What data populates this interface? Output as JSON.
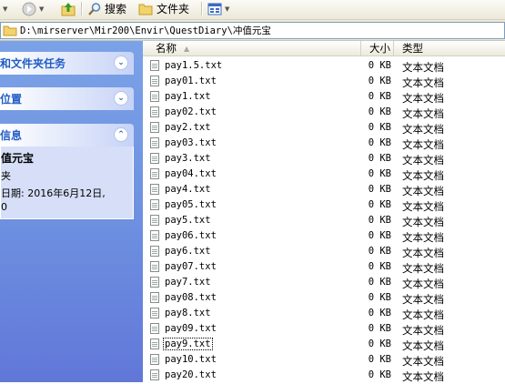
{
  "toolbar": {
    "search_label": "搜索",
    "folders_label": "文件夹"
  },
  "address": {
    "path": "D:\\mirserver\\Mir200\\Envir\\QuestDiary\\冲值元宝"
  },
  "taskpane": {
    "file_tasks_title": "和文件夹任务",
    "other_places_title": "位置",
    "details_title": "信息",
    "details": {
      "name": "值元宝",
      "type": "夹",
      "modified": "日期: 2016年6月12日,",
      "time_fragment": "0"
    }
  },
  "filelist": {
    "columns": {
      "name": "名称",
      "size": "大小",
      "type": "类型"
    },
    "files": [
      {
        "name": "pay1.5.txt",
        "size": "0 KB",
        "type": "文本文档"
      },
      {
        "name": "pay01.txt",
        "size": "0 KB",
        "type": "文本文档"
      },
      {
        "name": "pay1.txt",
        "size": "0 KB",
        "type": "文本文档"
      },
      {
        "name": "pay02.txt",
        "size": "0 KB",
        "type": "文本文档"
      },
      {
        "name": "pay2.txt",
        "size": "0 KB",
        "type": "文本文档"
      },
      {
        "name": "pay03.txt",
        "size": "0 KB",
        "type": "文本文档"
      },
      {
        "name": "pay3.txt",
        "size": "0 KB",
        "type": "文本文档"
      },
      {
        "name": "pay04.txt",
        "size": "0 KB",
        "type": "文本文档"
      },
      {
        "name": "pay4.txt",
        "size": "0 KB",
        "type": "文本文档"
      },
      {
        "name": "pay05.txt",
        "size": "0 KB",
        "type": "文本文档"
      },
      {
        "name": "pay5.txt",
        "size": "0 KB",
        "type": "文本文档"
      },
      {
        "name": "pay06.txt",
        "size": "0 KB",
        "type": "文本文档"
      },
      {
        "name": "pay6.txt",
        "size": "0 KB",
        "type": "文本文档"
      },
      {
        "name": "pay07.txt",
        "size": "0 KB",
        "type": "文本文档"
      },
      {
        "name": "pay7.txt",
        "size": "0 KB",
        "type": "文本文档"
      },
      {
        "name": "pay08.txt",
        "size": "0 KB",
        "type": "文本文档"
      },
      {
        "name": "pay8.txt",
        "size": "0 KB",
        "type": "文本文档"
      },
      {
        "name": "pay09.txt",
        "size": "0 KB",
        "type": "文本文档"
      },
      {
        "name": "pay9.txt",
        "size": "0 KB",
        "type": "文本文档",
        "focused": true
      },
      {
        "name": "pay10.txt",
        "size": "0 KB",
        "type": "文本文档"
      },
      {
        "name": "pay20.txt",
        "size": "0 KB",
        "type": "文本文档"
      }
    ]
  }
}
